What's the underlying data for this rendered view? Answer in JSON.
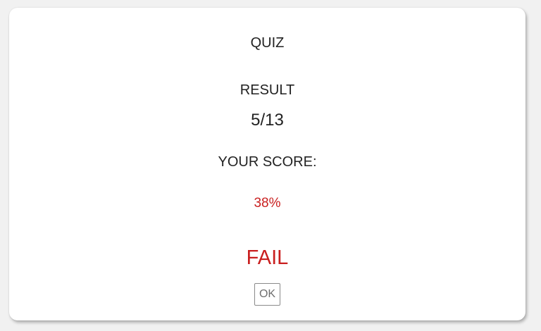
{
  "dialog": {
    "title": "QUIZ",
    "result_label": "RESULT",
    "result_value": "5/13",
    "score_label": "YOUR SCORE:",
    "score_value": "38%",
    "status": "FAIL",
    "ok_label": "OK"
  },
  "colors": {
    "background": "#f1f1f1",
    "card": "#ffffff",
    "text": "#222222",
    "fail": "#c91f1f"
  }
}
